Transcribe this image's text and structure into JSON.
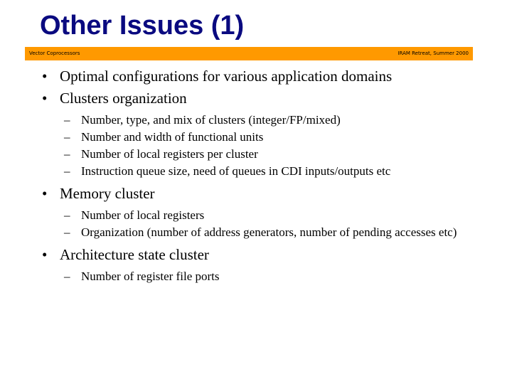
{
  "slide": {
    "title": "Other Issues (1)",
    "footer_left": "Vector Coprocessors",
    "footer_right": "IRAM Retreat, Summer 2000",
    "accent_color": "#ff9900",
    "title_color": "#0a0a80"
  },
  "bullets": [
    {
      "text": "Optimal configurations for various application domains",
      "sub": []
    },
    {
      "text": "Clusters organization",
      "sub": [
        "Number, type, and mix  of clusters (integer/FP/mixed)",
        "Number and width of functional units",
        "Number of local registers per cluster",
        "Instruction queue size, need of queues in CDI inputs/outputs etc"
      ]
    },
    {
      "text": "Memory cluster",
      "sub": [
        "Number of local registers",
        "Organization  (number of address generators, number of pending accesses etc)"
      ]
    },
    {
      "text": "Architecture state cluster",
      "sub": [
        "Number of register file ports"
      ]
    }
  ],
  "symbols": {
    "bullet": "•",
    "dash": "–"
  }
}
